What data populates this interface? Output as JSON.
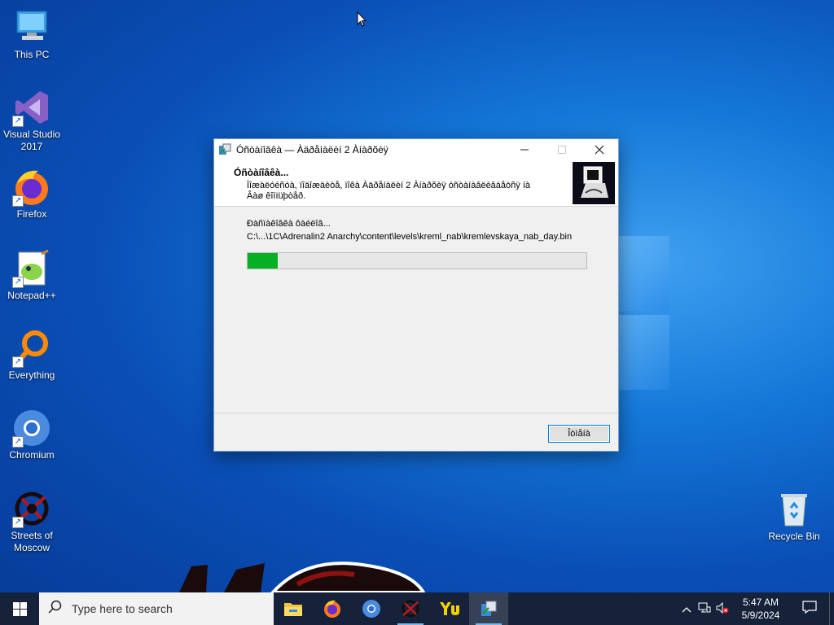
{
  "desktop": {
    "icons": [
      {
        "label": "This PC"
      },
      {
        "label": "Visual Studio 2017"
      },
      {
        "label": "Firefox"
      },
      {
        "label": "Notepad++"
      },
      {
        "label": "Everything"
      },
      {
        "label": "Chromium"
      },
      {
        "label": "Streets of Moscow"
      },
      {
        "label": "Recycle Bin"
      }
    ]
  },
  "dialog": {
    "title": "Óñòàíîâêà — Àäðåíàëèí 2 Àíàðõèÿ",
    "header_title": "Óñòàíîâêà...",
    "header_subtitle": "Ïîæàëóéñòà, ïîäîæäèòå, ïîêà Àäðåíàëèí 2 Àíàðõèÿ óñòàíàâëèâàåòñÿ íà Âàø êîìïüþòåð.",
    "status_label": "Ðàñïàêîâêà ôàéëîâ...",
    "file_path": "C:\\...\\1C\\Adrenalin2 Anarchy\\content\\levels\\kreml_nab\\kremlevskaya_nab_day.bin",
    "progress_percent": 9,
    "cancel_label": "Îòìåíà"
  },
  "taskbar": {
    "search_placeholder": "Type here to search",
    "time": "5:47 AM",
    "date": "5/9/2024"
  },
  "colors": {
    "progress_fill": "#06b025",
    "taskbar_bg": "#15223a",
    "accent": "#0078d7"
  }
}
